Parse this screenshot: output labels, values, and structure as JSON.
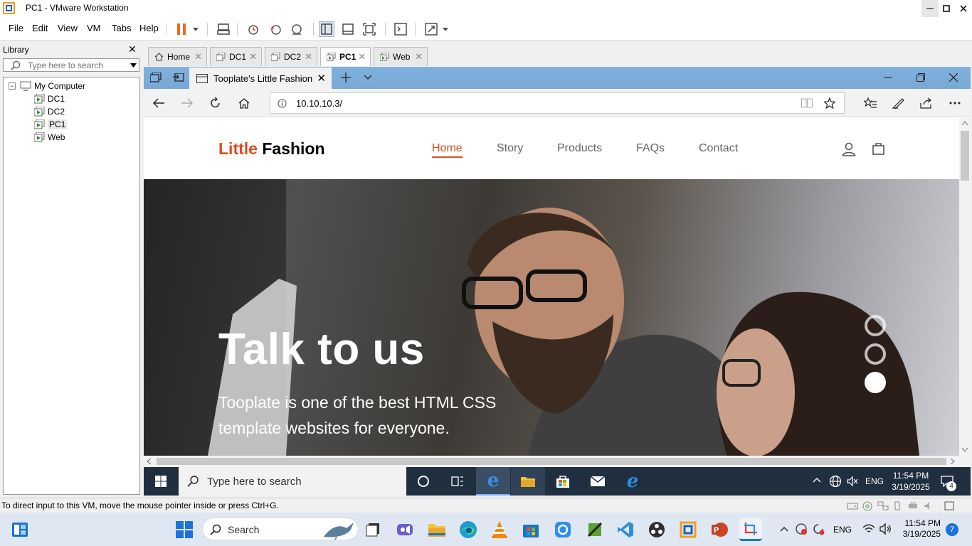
{
  "window": {
    "title": "PC1 - VMware Workstation"
  },
  "menu": [
    "File",
    "Edit",
    "View",
    "VM",
    "Tabs",
    "Help"
  ],
  "library": {
    "title": "Library",
    "search_placeholder": "Type here to search",
    "root": "My Computer",
    "vms": [
      "DC1",
      "DC2",
      "PC1",
      "Web"
    ]
  },
  "vm_tabs": [
    {
      "label": "Home",
      "active": false
    },
    {
      "label": "DC1",
      "active": false
    },
    {
      "label": "DC2",
      "active": false
    },
    {
      "label": "PC1",
      "active": true
    },
    {
      "label": "Web",
      "active": false
    }
  ],
  "edge": {
    "tab_title": "Tooplate's Little Fashion",
    "url": "10.10.10.3/"
  },
  "site": {
    "brand_accent": "Little",
    "brand_rest": " Fashion",
    "nav": [
      "Home",
      "Story",
      "Products",
      "FAQs",
      "Contact"
    ],
    "active_nav": "Home",
    "hero_title": "Talk to us",
    "hero_text": "Tooplate is one of the best HTML CSS template websites for everyone.",
    "accent_color": "#e14b1c",
    "carousel_active_index": 2
  },
  "guest_taskbar": {
    "search_placeholder": "Type here to search",
    "lang": "ENG",
    "time": "11:54 PM",
    "date": "3/19/2025",
    "notifications": "4"
  },
  "status_message": "To direct input to this VM, move the mouse pointer inside or press Ctrl+G.",
  "host_taskbar": {
    "search_placeholder": "Search",
    "lang": "ENG",
    "time": "11:54 PM",
    "date": "3/19/2025",
    "notifications": "7"
  }
}
